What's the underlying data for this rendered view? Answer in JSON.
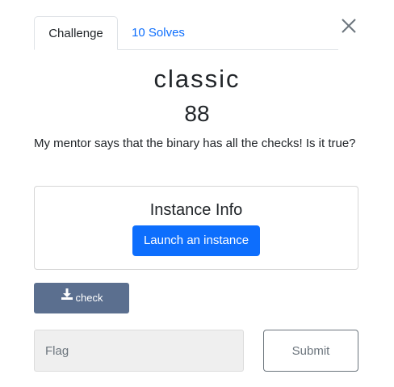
{
  "tabs": {
    "challenge_label": "Challenge",
    "solves_label": "10 Solves"
  },
  "challenge": {
    "name": "classic",
    "points": "88",
    "description": "My mentor says that the binary has all the checks! Is it true?"
  },
  "instance": {
    "title": "Instance Info",
    "launch_label": "Launch an instance"
  },
  "files": {
    "file_label": "check",
    "file_icon": "download-icon"
  },
  "flag_form": {
    "placeholder": "Flag",
    "submit_label": "Submit"
  },
  "colors": {
    "primary": "#0d6efd",
    "file_button": "#5b6f8f",
    "tab_link": "#0d6efd"
  }
}
